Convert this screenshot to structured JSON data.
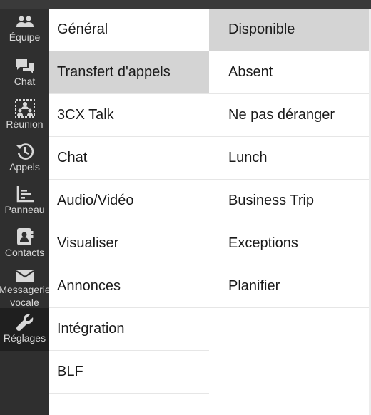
{
  "nav": {
    "items": [
      {
        "label": "Équipe",
        "icon": "users-icon"
      },
      {
        "label": "Chat",
        "icon": "chat-bubbles-icon"
      },
      {
        "label": "Réunion",
        "icon": "meeting-icon"
      },
      {
        "label": "Appels",
        "icon": "history-icon"
      },
      {
        "label": "Panneau",
        "icon": "panel-chart-icon"
      },
      {
        "label": "Contacts",
        "icon": "contact-card-icon"
      },
      {
        "label": "Messagerie vocale",
        "icon": "envelope-icon"
      },
      {
        "label": "Réglages",
        "icon": "wrench-icon"
      }
    ],
    "active": "Réglages"
  },
  "settings_menu": {
    "items": [
      "Général",
      "Transfert d'appels",
      "3CX Talk",
      "Chat",
      "Audio/Vidéo",
      "Visualiser",
      "Annonces",
      "Intégration",
      "BLF"
    ],
    "selected": "Transfert d'appels"
  },
  "status_menu": {
    "items": [
      "Disponible",
      "Absent",
      "Ne pas déranger",
      "Lunch",
      "Business Trip",
      "Exceptions",
      "Planifier"
    ],
    "selected": "Disponible"
  },
  "colors": {
    "nav_bg": "#2f2f2f",
    "nav_active": "#1f1f1f",
    "nav_text": "#d8d8d8",
    "selected_row": "#d4d4d4"
  }
}
